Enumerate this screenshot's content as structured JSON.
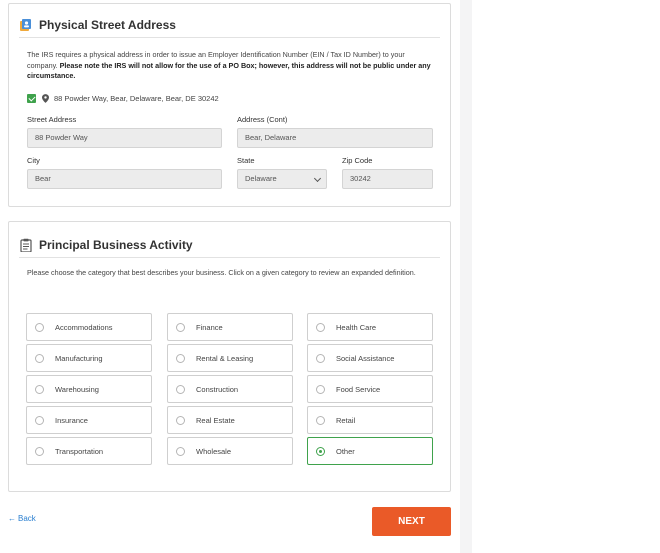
{
  "address_section": {
    "title": "Physical Street Address",
    "icon": "address-book-icon",
    "desc_normal": "The IRS requires a physical address in order to issue an Employer Identification Number (EIN / Tax ID Number) to your company. ",
    "desc_bold": "Please note the IRS will not allow for the use of a PO Box; however, this address will not be public under any circumstance.",
    "verified_address": "88 Powder Way, Bear, Delaware, Bear, DE 30242",
    "fields": {
      "street_label": "Street Address",
      "street_value": "88 Powder Way",
      "address_cont_label": "Address (Cont)",
      "address_cont_value": "Bear, Delaware",
      "city_label": "City",
      "city_value": "Bear",
      "state_label": "State",
      "state_value": "Delaware",
      "zip_label": "Zip Code",
      "zip_value": "30242"
    }
  },
  "activity_section": {
    "title": "Principal Business Activity",
    "icon": "clipboard-icon",
    "desc": "Please choose the category that best describes your business. Click on a given category to review an expanded definition.",
    "options": [
      "Accommodations",
      "Finance",
      "Health Care",
      "Manufacturing",
      "Rental & Leasing",
      "Social Assistance",
      "Warehousing",
      "Construction",
      "Food Service",
      "Insurance",
      "Real Estate",
      "Retail",
      "Transportation",
      "Wholesale",
      "Other"
    ],
    "selected": "Other"
  },
  "nav": {
    "back_label": "Back",
    "next_label": "NEXT"
  },
  "colors": {
    "accent_orange": "#ea5a28",
    "success_green": "#3fa24c",
    "link_blue": "#2a7fd0"
  }
}
